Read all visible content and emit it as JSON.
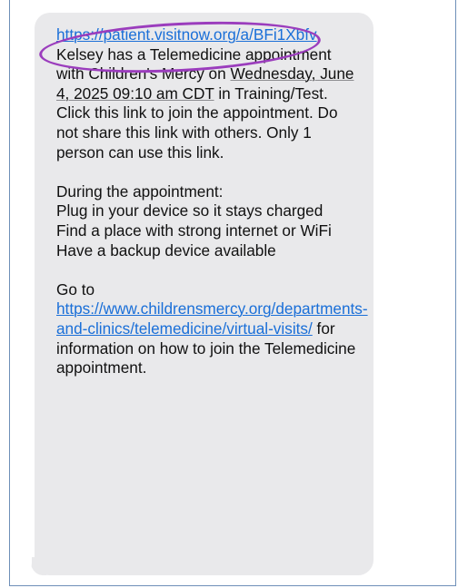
{
  "message": {
    "link1": "https://patient.visitnow.org/a/BFi1Xbfv",
    "intro_after_link": " Kelsey  has a Telemedicine appointment with Children's Mercy on ",
    "date": "Wednesday, June 4, 2025 09:10 am CDT",
    "intro_tail": " in Training/Test.",
    "instructions": "Click this link to join the appointment. Do not share this link with others. Only 1 person can use this link.",
    "during_heading": "During the appointment:",
    "tips": [
      "Plug in your device so it stays charged",
      "Find a place with strong internet or WiFi",
      "Have a backup device available"
    ],
    "goto_prefix": "Go to ",
    "link2": "https://www.childrensmercy.org/departments-and-clinics/telemedicine/virtual-visits/",
    "goto_suffix": " for information on how to join the Telemedicine appointment."
  },
  "colors": {
    "bubble": "#e9e9eb",
    "link": "#1a6fd8",
    "annotation": "#9b3dbd",
    "frame_border": "#6e8fb8"
  }
}
